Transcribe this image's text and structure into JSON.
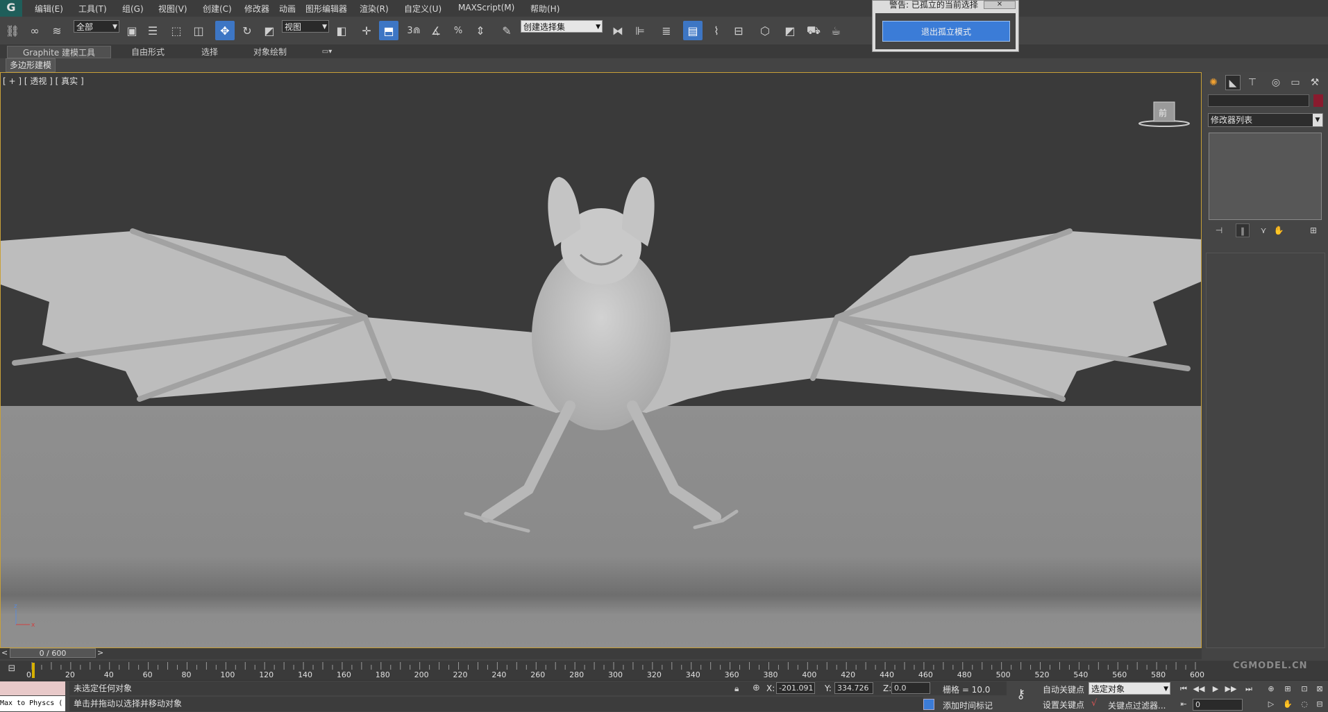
{
  "menu": {
    "logo": "G",
    "items": [
      "编辑(E)",
      "工具(T)",
      "组(G)",
      "视图(V)",
      "创建(C)",
      "修改器",
      "动画",
      "图形编辑器",
      "渲染(R)",
      "自定义(U)",
      "MAXScript(M)",
      "帮助(H)"
    ]
  },
  "toolbar": {
    "selection_filter": "全部",
    "ref_coord": "视图",
    "named_selection": "创建选择集",
    "snap_label": "3"
  },
  "ribbon": {
    "tabs": [
      "Graphite 建模工具",
      "自由形式",
      "选择",
      "对象绘制"
    ],
    "sub_tab": "多边形建模"
  },
  "viewport": {
    "label": "[ + ] [ 透视 ] [ 真实 ]",
    "viewcube_face": "前",
    "axis_z": "z",
    "axis_x": "x"
  },
  "dialog": {
    "title": "警告: 已孤立的当前选择",
    "close": "✕",
    "button": "退出孤立模式"
  },
  "command_panel": {
    "modifier_list": "修改器列表",
    "color": "#8a1b2e"
  },
  "timeline": {
    "slider": "0 / 600",
    "ticks": [
      "0",
      "20",
      "40",
      "60",
      "80",
      "100",
      "120",
      "140",
      "160",
      "180",
      "200",
      "220",
      "240",
      "260",
      "280",
      "300",
      "320",
      "340",
      "360",
      "380",
      "400",
      "420",
      "440",
      "460",
      "480",
      "500",
      "520",
      "540",
      "560",
      "580",
      "600"
    ]
  },
  "status": {
    "maxscript": "Max to Physcs (",
    "prompt1": "未选定任何对象",
    "prompt2": "单击并拖动以选择并移动对象",
    "x_label": "X:",
    "x_value": "-201.091",
    "y_label": "Y:",
    "y_value": "334.726",
    "z_label": "Z:",
    "z_value": "0.0",
    "grid": "栅格 = 10.0",
    "add_time_tag": "添加时间标记",
    "auto_key": "自动关键点",
    "set_key": "设置关键点",
    "selected_object": "选定对象",
    "key_filters": "关键点过滤器...",
    "frame_field": "0"
  },
  "watermark": "CGMODEL.CN"
}
